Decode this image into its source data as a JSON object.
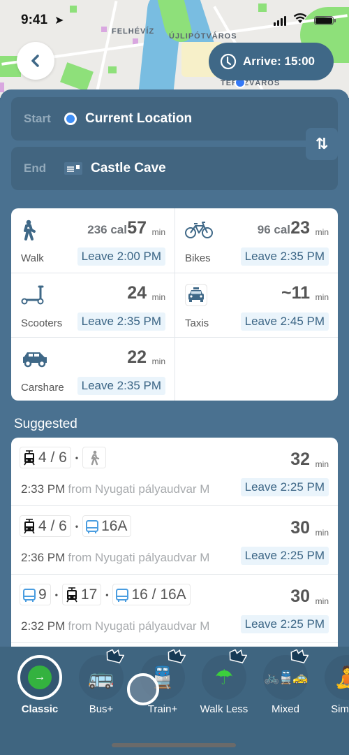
{
  "status_bar": {
    "time": "9:41",
    "location_icon": "location-arrow-icon",
    "signal_icon": "cellular-signal-icon",
    "wifi_icon": "wifi-icon",
    "battery_icon": "battery-icon"
  },
  "map": {
    "labels": [
      "FELHÉVÍZ",
      "ÚJLIPÓTVÁROS",
      "TERÉZVÁROS"
    ]
  },
  "header": {
    "back_icon": "chevron-left-icon",
    "arrive_label": "Arrive: 15:00",
    "arrive_icon": "clock-icon"
  },
  "trip": {
    "start_label": "Start",
    "start_value": "Current Location",
    "end_label": "End",
    "end_value": "Castle Cave",
    "swap_icon": "swap-arrows-icon",
    "swap_glyph": "⇅"
  },
  "modes": [
    {
      "name": "Walk",
      "icon": "walk-icon",
      "calories": "236 cal",
      "duration": "57",
      "unit": "min",
      "leave": "Leave 2:00 PM"
    },
    {
      "name": "Bikes",
      "icon": "bike-icon",
      "calories": "96 cal",
      "duration": "23",
      "unit": "min",
      "leave": "Leave 2:35 PM"
    },
    {
      "name": "Scooters",
      "icon": "scooter-icon",
      "calories": "",
      "duration": "24",
      "unit": "min",
      "leave": "Leave 2:35 PM"
    },
    {
      "name": "Taxis",
      "icon": "taxi-icon",
      "calories": "",
      "duration": "~11",
      "unit": "min",
      "leave": "Leave 2:45 PM"
    },
    {
      "name": "Carshare",
      "icon": "car-icon",
      "calories": "",
      "duration": "22",
      "unit": "min",
      "leave": "Leave 2:35 PM"
    }
  ],
  "suggested": {
    "title": "Suggested",
    "routes": [
      {
        "chips": [
          {
            "type": "tram",
            "label": "4 / 6"
          },
          {
            "type": "walk",
            "label": ""
          }
        ],
        "duration": "32",
        "unit": "min",
        "time": "2:33 PM",
        "from": "from Nyugati pályaudvar M",
        "leave": "Leave 2:25 PM"
      },
      {
        "chips": [
          {
            "type": "tram",
            "label": "4 / 6"
          },
          {
            "type": "bus",
            "label": "16A"
          }
        ],
        "duration": "30",
        "unit": "min",
        "time": "2:36 PM",
        "from": "from Nyugati pályaudvar M",
        "leave": "Leave 2:25 PM"
      },
      {
        "chips": [
          {
            "type": "bus",
            "label": "9"
          },
          {
            "type": "tram",
            "label": "17"
          },
          {
            "type": "bus",
            "label": "16 / 16A"
          }
        ],
        "duration": "30",
        "unit": "min",
        "time": "2:32 PM",
        "from": "from Nyugati pályaudvar M",
        "leave": "Leave 2:25 PM"
      }
    ],
    "separator": "•"
  },
  "optimizers": [
    {
      "label": "Classic",
      "emoji": "",
      "selected": true,
      "premium": false
    },
    {
      "label": "Bus+",
      "emoji": "🚌",
      "selected": false,
      "premium": true
    },
    {
      "label": "Train+",
      "emoji": "🚆",
      "selected": false,
      "premium": true
    },
    {
      "label": "Walk Less",
      "emoji": "☂",
      "selected": false,
      "premium": true
    },
    {
      "label": "Mixed",
      "emoji": "🚲🚆🚕",
      "selected": false,
      "premium": true
    },
    {
      "label": "Simple",
      "emoji": "🧘",
      "selected": false,
      "premium": false
    }
  ],
  "colors": {
    "panel": "#4a7190",
    "accent": "#3b6585",
    "leave_bg": "#eaf4fb",
    "go_green": "#34b23f",
    "current_dot": "#3d8ef7"
  }
}
